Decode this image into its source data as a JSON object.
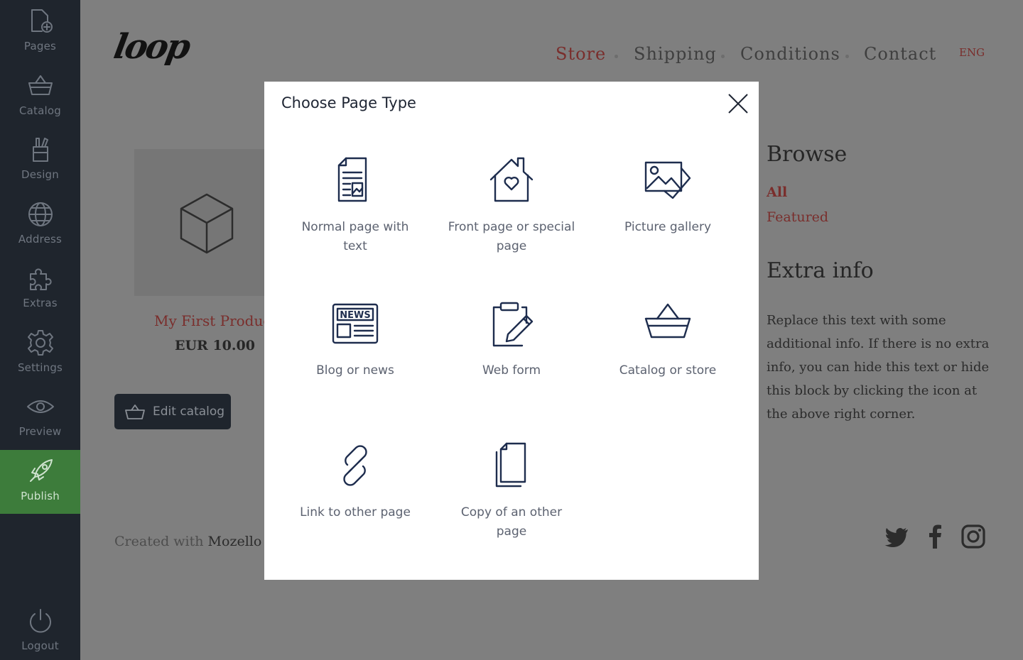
{
  "sidebar": {
    "items": [
      {
        "label": "Pages",
        "icon": "add-page-icon"
      },
      {
        "label": "Catalog",
        "icon": "basket-icon"
      },
      {
        "label": "Design",
        "icon": "design-tools-icon"
      },
      {
        "label": "Address",
        "icon": "globe-icon"
      },
      {
        "label": "Extras",
        "icon": "puzzle-icon"
      },
      {
        "label": "Settings",
        "icon": "gear-icon"
      },
      {
        "label": "Preview",
        "icon": "eye-icon"
      },
      {
        "label": "Publish",
        "icon": "rocket-icon"
      }
    ],
    "logout": {
      "label": "Logout",
      "icon": "power-icon"
    },
    "colors": {
      "background": "#1f252d",
      "publish": "#3d7c3b"
    }
  },
  "site": {
    "logo": "loop",
    "nav": [
      "Store",
      "Shipping",
      "Conditions",
      "Contact"
    ],
    "active_nav": "Store",
    "lang": "ENG",
    "product": {
      "name": "My First Product",
      "price": "EUR 10.00"
    },
    "edit_catalog_label": "Edit catalog",
    "footer": {
      "prefix": "Created with",
      "brand": "Mozello",
      "suffix": " -"
    },
    "browse": {
      "title": "Browse",
      "links": [
        "All",
        "Featured"
      ]
    },
    "extra": {
      "title": "Extra info",
      "text": "Replace this text with some additional info. If there is no extra info, you can hide this text or hide this block by clicking the icon at the above right corner."
    },
    "social": [
      "twitter-icon",
      "facebook-icon",
      "instagram-icon"
    ],
    "accent_color": "#7a2e2c"
  },
  "modal": {
    "title": "Choose Page Type",
    "options": [
      {
        "label": "Normal page with text",
        "icon": "document-icon"
      },
      {
        "label": "Front page or special page",
        "icon": "home-heart-icon"
      },
      {
        "label": "Picture gallery",
        "icon": "pictures-icon"
      },
      {
        "label": "Blog or news",
        "icon": "newspaper-icon"
      },
      {
        "label": "Web form",
        "icon": "clipboard-pen-icon"
      },
      {
        "label": "Catalog or store",
        "icon": "basket-icon"
      },
      {
        "label": "Link to other page",
        "icon": "link-icon"
      },
      {
        "label": "Copy of an other page",
        "icon": "copy-icon"
      }
    ]
  }
}
